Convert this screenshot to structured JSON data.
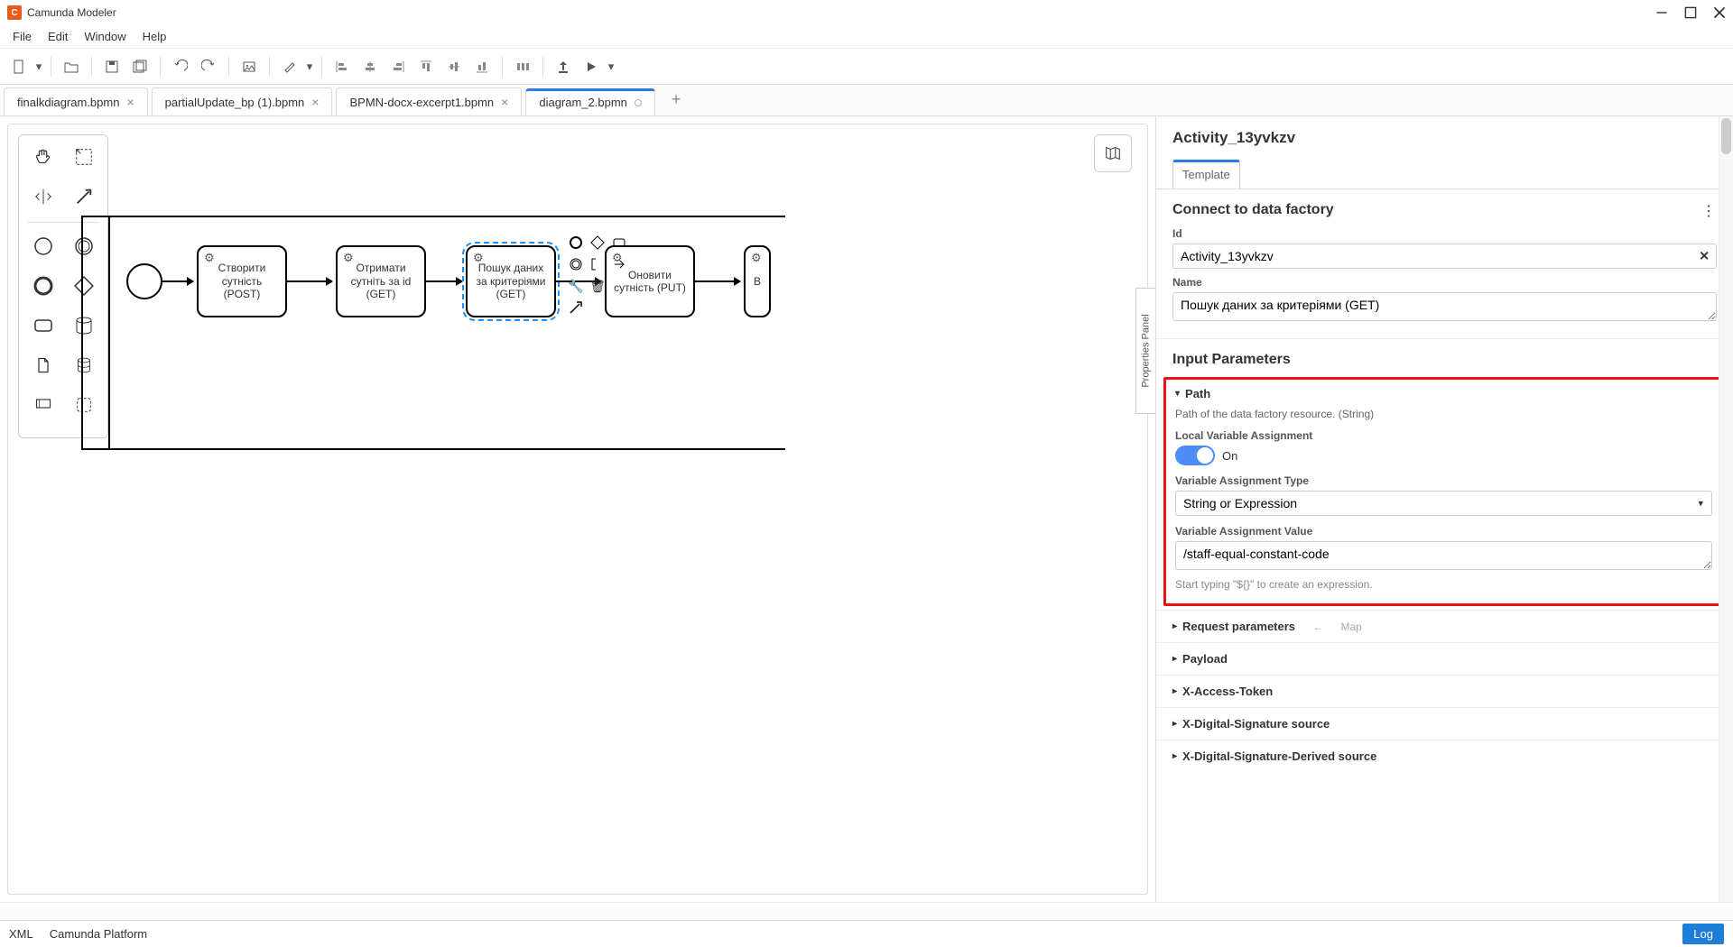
{
  "window": {
    "title": "Camunda Modeler"
  },
  "menu": {
    "file": "File",
    "edit": "Edit",
    "window": "Window",
    "help": "Help"
  },
  "tabs": {
    "t1": "finalkdiagram.bpmn",
    "t2": "partialUpdate_bp (1).bpmn",
    "t3": "BPMN-docx-excerpt1.bpmn",
    "t4": "diagram_2.bpmn"
  },
  "diagram": {
    "task1": "Створити сутність (POST)",
    "task2": "Отримати сутніть за id (GET)",
    "task3": "Пошук даних за критеріями (GET)",
    "task4": "Оновити сутність (PUT)",
    "task5": "В"
  },
  "panel": {
    "activity_title": "Activity_13yvkzv",
    "tab_template": "Template",
    "section_title": "Connect to data factory",
    "id_label": "Id",
    "id_value": "Activity_13yvkzv",
    "name_label": "Name",
    "name_value": "Пошук даних за критеріями (GET)",
    "input_params_heading": "Input Parameters",
    "path_label": "Path",
    "path_desc": "Path of the data factory resource. (String)",
    "lva_label": "Local Variable Assignment",
    "lva_state": "On",
    "vat_label": "Variable Assignment Type",
    "vat_value": "String or Expression",
    "vav_label": "Variable Assignment Value",
    "vav_value": "/staff-equal-constant-code",
    "vav_hint": "Start typing \"${}\" to create an expression.",
    "coll_request": "Request parameters",
    "coll_request_tag": "Map",
    "coll_payload": "Payload",
    "coll_xaccess": "X-Access-Token",
    "coll_xdigsig": "X-Digital-Signature source",
    "coll_xdigsigder": "X-Digital-Signature-Derived source",
    "pp_handle": "Properties Panel"
  },
  "status": {
    "xml": "XML",
    "platform": "Camunda Platform",
    "log": "Log"
  },
  "chart_data": null
}
